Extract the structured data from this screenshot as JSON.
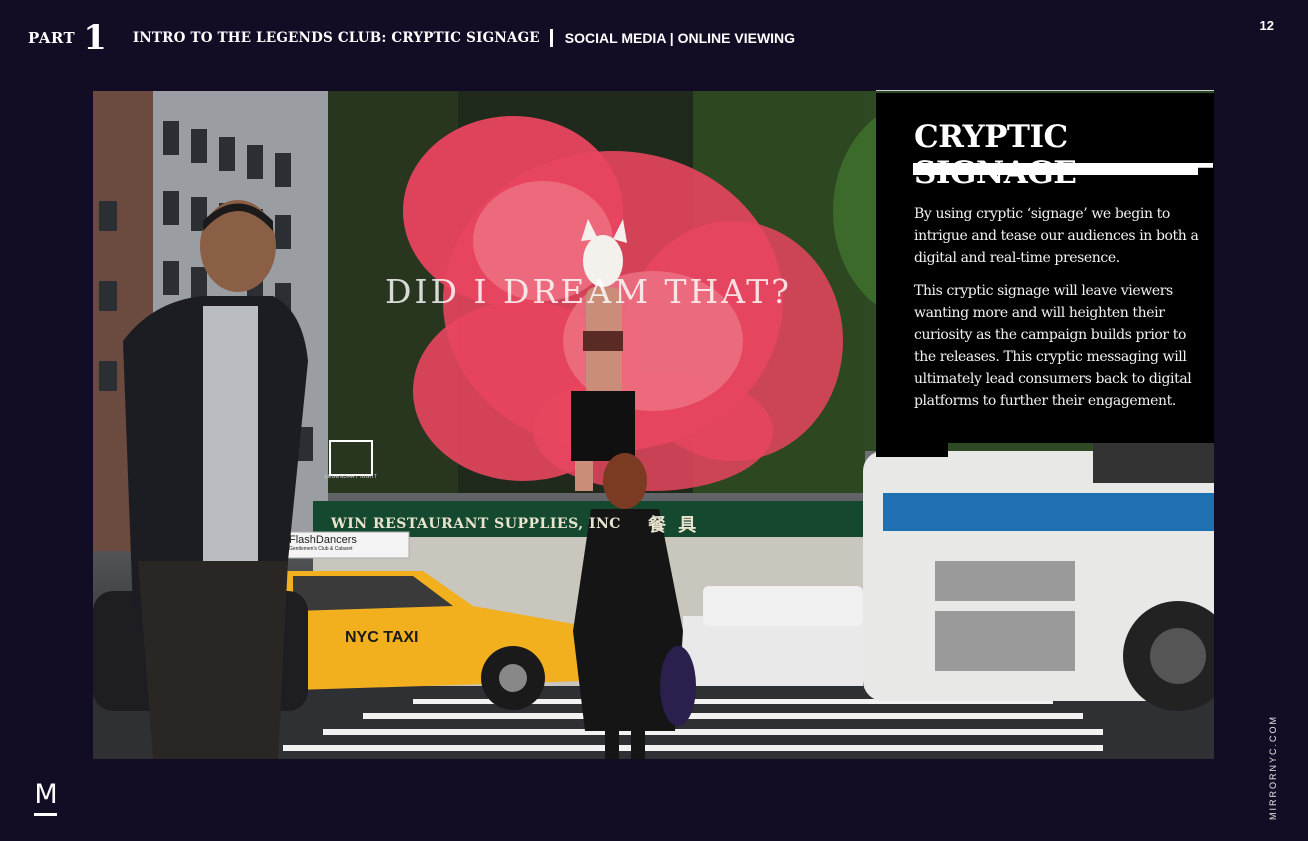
{
  "header": {
    "part_label": "PART",
    "part_number": "1",
    "intro_title": "INTRO TO THE LEGENDS CLUB: CRYPTIC SIGNAGE",
    "section_label": "SOCIAL MEDIA | ONLINE VIEWING"
  },
  "page_number": "12",
  "photo": {
    "billboard_text": "DID I DREAM THAT?",
    "billboard_brand": "LEGENDARY NIGHT",
    "storefront_sign": "WIN RESTAURANT SUPPLIES, INC",
    "storefront_sign_cn": "餐 具",
    "taxi_roof_ad": "FlashDancers",
    "taxi_roof_ad_small": "Gentlemen's Club & Cabaret",
    "taxi_label": "NYC TAXI"
  },
  "panel": {
    "title": "CRYPTIC SIGNAGE",
    "paragraphs": [
      "By using cryptic ‘signage’ we begin to intrigue and tease our audiences in both a digital and real-time presence.",
      "This cryptic signage will leave viewers wanting more and will heighten their curiosity as the campaign builds prior to the releases. This cryptic messaging will ultimately lead consumers back to digital platforms to further their engagement."
    ]
  },
  "footer": {
    "logo_letter": "M",
    "site_url": "MIRRORNYC.COM"
  },
  "colors": {
    "background": "#120c25",
    "panel": "#000000",
    "smoke": "#e8455f",
    "taxi": "#f2b01e",
    "bus_stripe": "#1f6fb3"
  }
}
